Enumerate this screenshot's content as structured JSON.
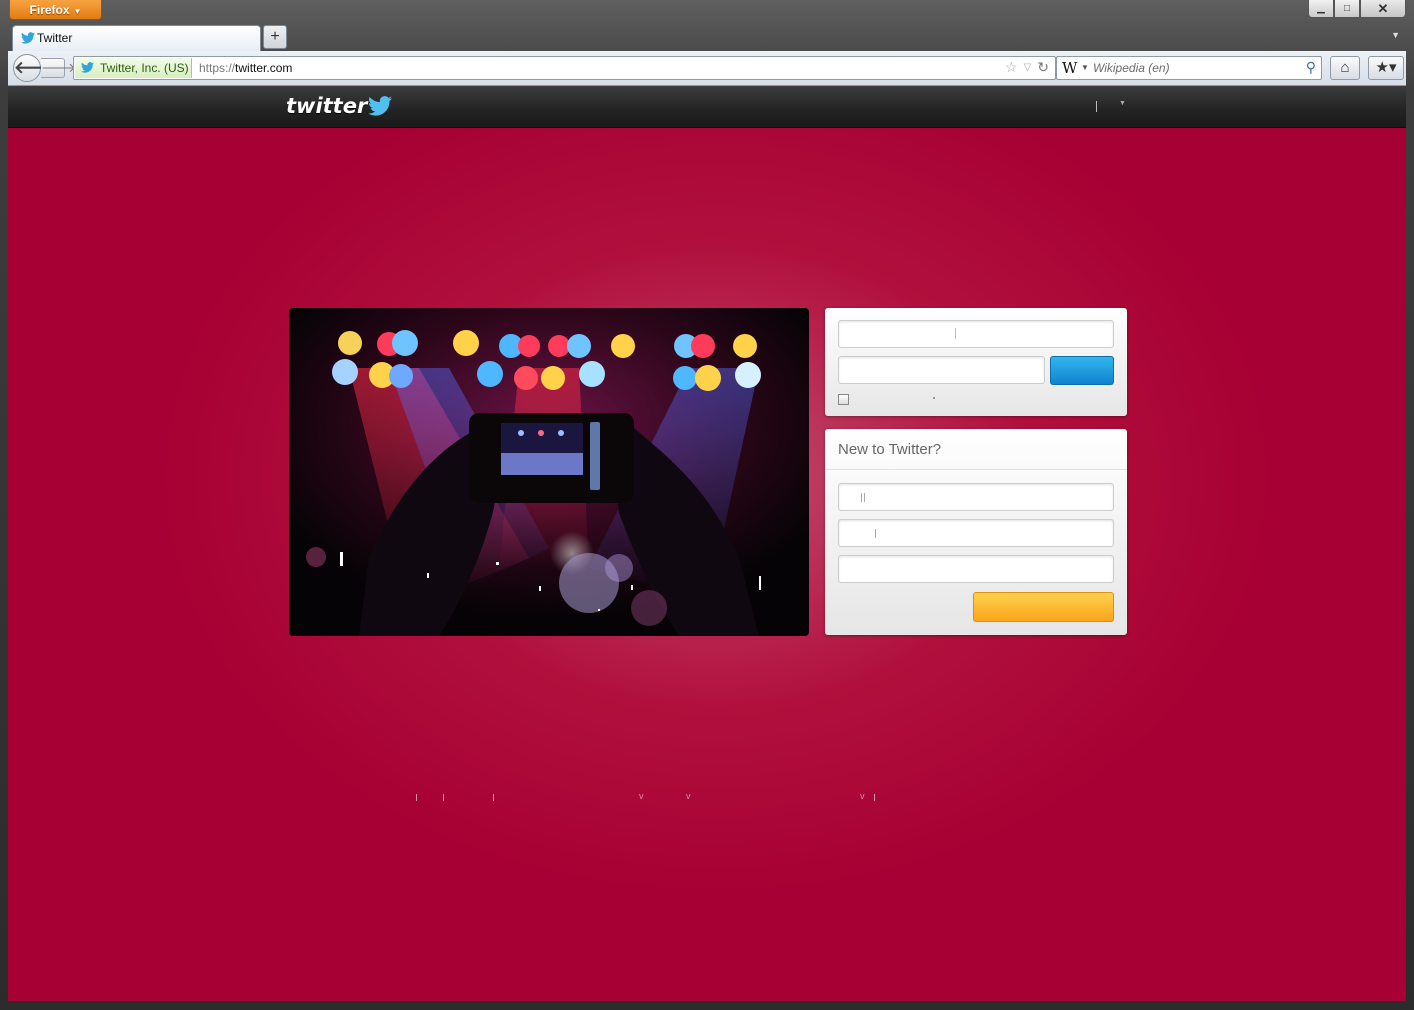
{
  "browser": {
    "menu_button": "Firefox",
    "tab_title": "Twitter",
    "new_tab": "+",
    "identity_label": "Twitter, Inc. (US)",
    "url_scheme": "https://",
    "url_host": "twitter.com",
    "search_engine_glyph": "W",
    "search_placeholder": "Wikipedia (en)",
    "icons": [
      "back-icon",
      "forward-icon",
      "star-icon",
      "reload-icon",
      "search-go-icon",
      "home-icon",
      "bookmarks-icon"
    ]
  },
  "page": {
    "logo": "twitter",
    "signup": {
      "title": "New to Twitter?"
    }
  },
  "colors": {
    "background": "#a70034",
    "signin_button": "#1d9ee0",
    "signup_button": "#fbb525",
    "topbar": "#222222"
  }
}
